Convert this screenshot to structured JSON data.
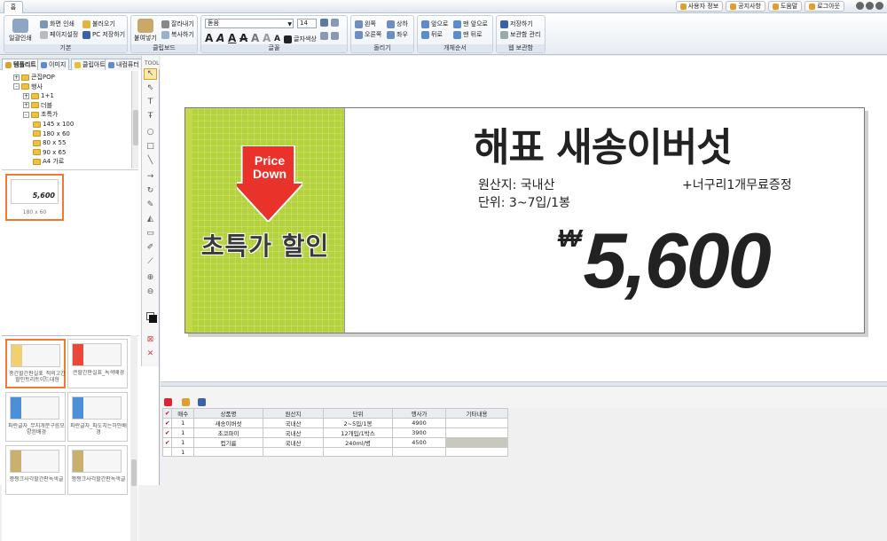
{
  "app": {
    "home_tab": "홈"
  },
  "top_links": [
    "사용자 정보",
    "공지사항",
    "도움말",
    "로그아웃"
  ],
  "ribbon": {
    "group_basic": {
      "title": "기본",
      "print_label": "일괄인쇄",
      "screen_print": "화면 인쇄",
      "page_setup": "페이지설정",
      "open": "불러오기",
      "pc_save": "PC 저장하기"
    },
    "group_clipboard": {
      "title": "클립보드",
      "paste": "붙여넣기",
      "cut": "잘라내기",
      "copy": "복사하기"
    },
    "group_font": {
      "title": "글꼴",
      "font_name": "돋움",
      "font_size": "14",
      "font_color_label": "글자색상"
    },
    "group_rotate": {
      "title": "돌리기",
      "left": "왼쪽",
      "right": "오른쪽",
      "flip_v": "상하",
      "flip_h": "좌우"
    },
    "group_order": {
      "title": "개체순서",
      "forward": "앞으로",
      "front": "맨 앞으로",
      "backward": "뒤로",
      "back": "맨 뒤로"
    },
    "group_web": {
      "title": "웹 보관함",
      "save": "저장하기",
      "manage": "보관함 관리"
    }
  },
  "left_tabs": [
    "템플리트",
    "이미지",
    "클립아트",
    "내컴퓨터"
  ],
  "tree": [
    {
      "label": "큰집POP",
      "level": 1,
      "toggle": "+"
    },
    {
      "label": "행사",
      "level": 1,
      "toggle": "-"
    },
    {
      "label": "1+1",
      "level": 2,
      "toggle": "+"
    },
    {
      "label": "더블",
      "level": 2,
      "toggle": "+"
    },
    {
      "label": "초특가",
      "level": 2,
      "toggle": "-"
    },
    {
      "label": "145 x 100",
      "level": 3,
      "toggle": ""
    },
    {
      "label": "180 x 60",
      "level": 3,
      "toggle": ""
    },
    {
      "label": "80 x 55",
      "level": 3,
      "toggle": ""
    },
    {
      "label": "90 x 65",
      "level": 3,
      "toggle": ""
    },
    {
      "label": "A4 가로",
      "level": 3,
      "toggle": ""
    }
  ],
  "selected_thumb": {
    "caption": "180 x 60",
    "mini_price": "5,600"
  },
  "templates": [
    {
      "caption": "중간할간판실표_적의고간할인트리트이드대형"
    },
    {
      "caption": "큰할간판실표_녹색배경"
    },
    {
      "caption": "파란글자_무지개분구름모양흰배경"
    },
    {
      "caption": "파란글자_파도치는하얀배경"
    },
    {
      "caption": "짱짱크사각할간판녹색글"
    },
    {
      "caption": "짱짱크사각할간판녹색글"
    }
  ],
  "poster": {
    "badge_line1": "Price",
    "badge_line2": "Down",
    "sale_text": "초특가 할인",
    "title": "해표 새송이버섯",
    "origin": "원산지:  국내산",
    "unit": "단위:  3~7입/1봉",
    "gift": "+너구리1개무료증정",
    "currency": "₩",
    "price": "5,600",
    "colors": {
      "left_panel": "#b3d23c",
      "arrow": "#e8322a"
    }
  },
  "grid": {
    "headers": [
      "매수",
      "상품명",
      "원산지",
      "단위",
      "행사가",
      "기타내용"
    ],
    "rows": [
      {
        "check": "✔",
        "count": "1",
        "name": "새송이버섯",
        "origin": "국내산",
        "unit": "2~5입/1봉",
        "price": "4900",
        "etc": ""
      },
      {
        "check": "✔",
        "count": "1",
        "name": "초코파이",
        "origin": "국내산",
        "unit": "12개입/1박스",
        "price": "3900",
        "etc": ""
      },
      {
        "check": "✔",
        "count": "1",
        "name": "컵기름",
        "origin": "국내산",
        "unit": "240ml/병",
        "price": "4500",
        "etc": ""
      },
      {
        "check": "",
        "count": "1",
        "name": "",
        "origin": "",
        "unit": "",
        "price": "",
        "etc": ""
      }
    ]
  }
}
